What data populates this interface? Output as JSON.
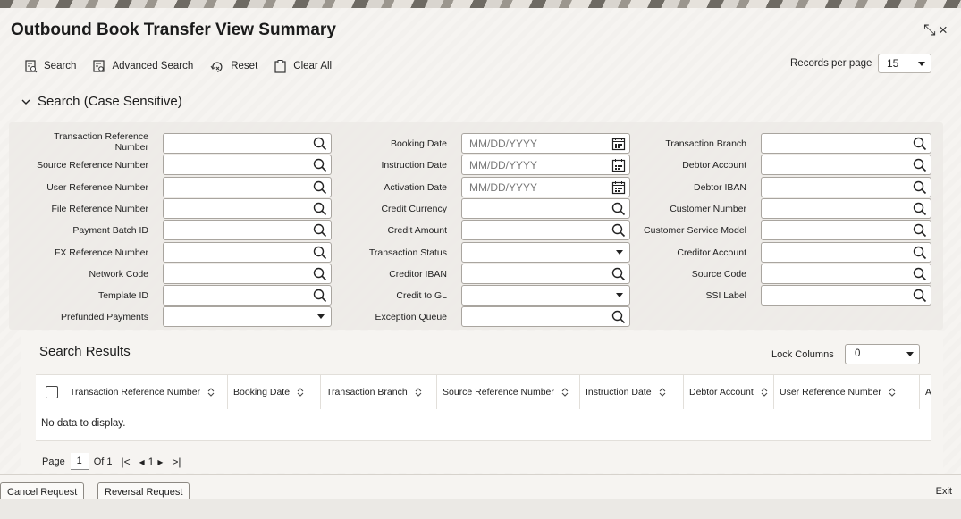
{
  "window": {
    "title": "Outbound Book Transfer View Summary",
    "close_icon": "×",
    "resize_icon": "⤡"
  },
  "toolbar": {
    "search": "Search",
    "advanced_search": "Advanced Search",
    "reset": "Reset",
    "clear_all": "Clear All",
    "records_per_page_label": "Records per page",
    "records_per_page_value": "15"
  },
  "search_section": {
    "title": "Search (Case Sensitive)"
  },
  "fields": {
    "col1": [
      {
        "label": "Transaction Reference Number",
        "type": "lookup"
      },
      {
        "label": "Source Reference Number",
        "type": "lookup"
      },
      {
        "label": "User Reference Number",
        "type": "lookup"
      },
      {
        "label": "File Reference Number",
        "type": "lookup"
      },
      {
        "label": "Payment Batch ID",
        "type": "lookup"
      },
      {
        "label": "FX Reference Number",
        "type": "lookup"
      },
      {
        "label": "Network Code",
        "type": "lookup"
      },
      {
        "label": "Template ID",
        "type": "lookup"
      },
      {
        "label": "Prefunded Payments",
        "type": "select"
      }
    ],
    "col2": [
      {
        "label": "Booking Date",
        "type": "date",
        "placeholder": "MM/DD/YYYY"
      },
      {
        "label": "Instruction Date",
        "type": "date",
        "placeholder": "MM/DD/YYYY"
      },
      {
        "label": "Activation Date",
        "type": "date",
        "placeholder": "MM/DD/YYYY"
      },
      {
        "label": "Credit Currency",
        "type": "lookup"
      },
      {
        "label": "Credit Amount",
        "type": "lookup"
      },
      {
        "label": "Transaction Status",
        "type": "select"
      },
      {
        "label": "Creditor IBAN",
        "type": "lookup"
      },
      {
        "label": "Credit to GL",
        "type": "select"
      },
      {
        "label": "Exception Queue",
        "type": "lookup"
      }
    ],
    "col3": [
      {
        "label": "Transaction Branch",
        "type": "lookup"
      },
      {
        "label": "Debtor Account",
        "type": "lookup"
      },
      {
        "label": "Debtor IBAN",
        "type": "lookup"
      },
      {
        "label": "Customer Number",
        "type": "lookup"
      },
      {
        "label": "Customer Service Model",
        "type": "lookup"
      },
      {
        "label": "Creditor Account",
        "type": "lookup"
      },
      {
        "label": "Source Code",
        "type": "lookup"
      },
      {
        "label": "SSI Label",
        "type": "lookup"
      }
    ]
  },
  "results": {
    "title": "Search Results",
    "lock_columns_label": "Lock Columns",
    "lock_columns_value": "0",
    "columns": [
      "Transaction Reference Number",
      "Booking Date",
      "Transaction Branch",
      "Source Reference Number",
      "Instruction Date",
      "Debtor Account",
      "User Reference Number",
      "A"
    ],
    "empty_message": "No data to display.",
    "pager": {
      "page_label": "Page",
      "page": "1",
      "of_label": "Of 1",
      "first": "|<",
      "prev": "◂",
      "current": "1",
      "next": "▸",
      "last": ">|"
    }
  },
  "footer": {
    "cancel_request": "Cancel Request",
    "reversal_request": "Reversal Request",
    "exit": "Exit"
  }
}
